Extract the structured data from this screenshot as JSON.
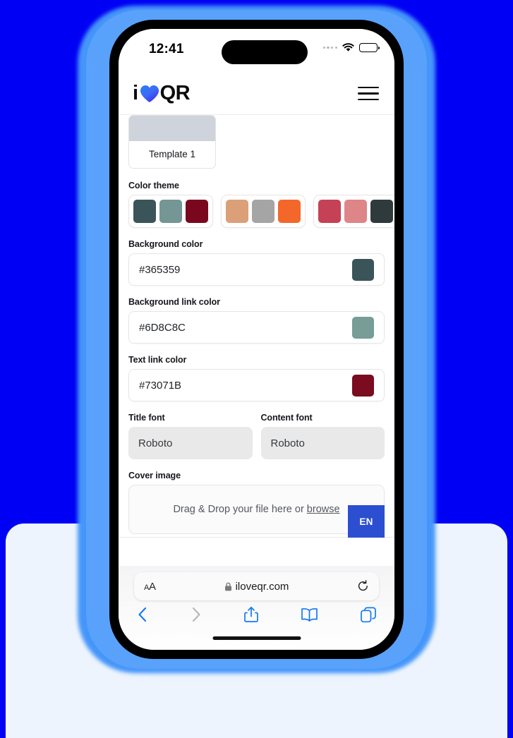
{
  "background": {
    "page_color": "#0000F5",
    "panel_color": "#EDF4FD",
    "glow_color": "#5AA2FB"
  },
  "status_bar": {
    "time": "12:41",
    "signal_icon": "signal-dots-icon",
    "wifi_icon": "wifi-icon",
    "battery_icon": "battery-full-icon"
  },
  "site_header": {
    "logo_prefix": "i",
    "logo_heart_icon": "heart-icon",
    "logo_suffix": "QR",
    "menu_icon": "hamburger-menu-icon"
  },
  "form": {
    "template": {
      "name": "Template 1"
    },
    "color_theme": {
      "label": "Color theme",
      "themes": [
        {
          "swatches": [
            "#3B5459",
            "#749694",
            "#79081F"
          ]
        },
        {
          "swatches": [
            "#DCA078",
            "#A5A5A5",
            "#F4672A"
          ]
        },
        {
          "swatches": [
            "#C54155",
            "#DD8587",
            "#2F3A3C"
          ]
        }
      ]
    },
    "background_color": {
      "label": "Background color",
      "value": "#365359",
      "chip": "#3B5459"
    },
    "background_link_color": {
      "label": "Background link color",
      "value": "#6D8C8C",
      "chip": "#779D96"
    },
    "text_link_color": {
      "label": "Text link color",
      "value": "#73071B",
      "chip": "#7B0B1E"
    },
    "title_font": {
      "label": "Title font",
      "value": "Roboto"
    },
    "content_font": {
      "label": "Content font",
      "value": "Roboto"
    },
    "cover_image": {
      "label": "Cover image",
      "dropzone_text": "Drag & Drop your file here or",
      "browse_label": "browse"
    }
  },
  "language_button": {
    "label": "EN",
    "color": "#2B4FD0"
  },
  "safari": {
    "text_size_button": "AA",
    "lock_icon": "lock-icon",
    "url": "iloveqr.com",
    "reload_icon": "reload-icon",
    "back_icon": "back-chevron-icon",
    "forward_icon": "forward-chevron-icon",
    "share_icon": "share-icon",
    "bookmarks_icon": "book-icon",
    "tabs_icon": "tabs-icon"
  }
}
